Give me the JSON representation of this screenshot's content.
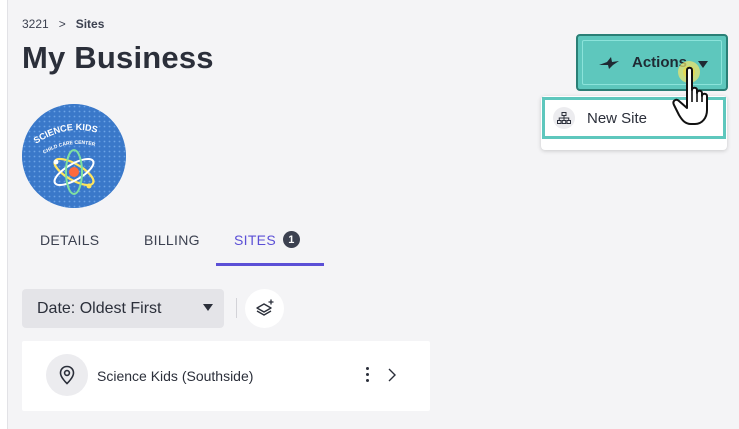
{
  "breadcrumb": {
    "parent": "3221",
    "separator": ">",
    "current": "Sites"
  },
  "page_title": "My Business",
  "logo": {
    "line1": "SCIENCE KIDS",
    "line2": "CHILD CARE CENTER"
  },
  "tabs": [
    {
      "label": "DETAILS",
      "active": false
    },
    {
      "label": "BILLING",
      "active": false
    },
    {
      "label": "SITES",
      "active": true,
      "badge": "1"
    }
  ],
  "sort": {
    "selected": "Date: Oldest First"
  },
  "sites": [
    {
      "name": "Science Kids (Southside)"
    }
  ],
  "actions": {
    "label": "Actions"
  },
  "menu": {
    "items": [
      {
        "label": "New Site",
        "icon": "sitemap-icon"
      }
    ]
  },
  "colors": {
    "accent": "#5b4fd6",
    "teal": "#5ec7bd",
    "teal_border": "#2a7f76",
    "panel_bg": "#f4f4f6"
  },
  "icons": {
    "actions": "bird-icon",
    "layers": "layers-plus-icon",
    "site": "map-pin-icon",
    "more": "kebab-icon",
    "open": "chevron-right-icon",
    "cursor": "hand-pointer-icon"
  }
}
